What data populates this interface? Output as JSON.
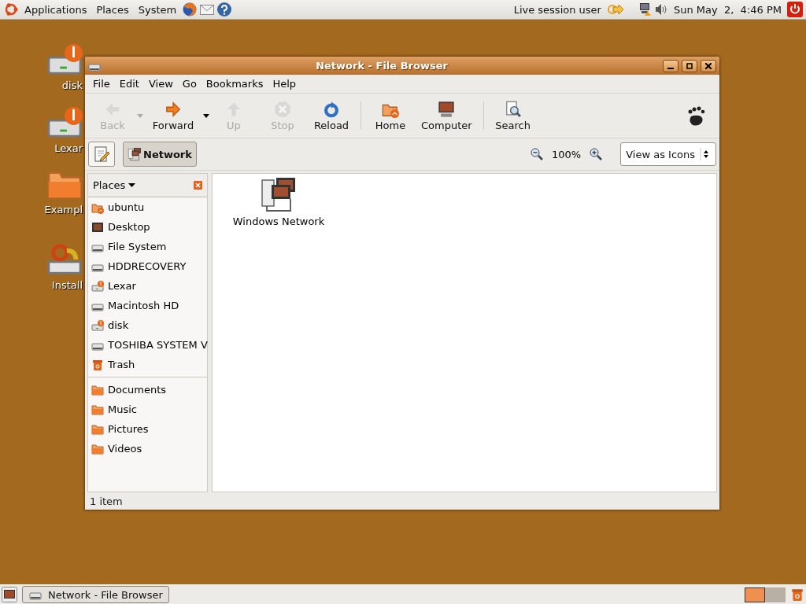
{
  "top_panel": {
    "menus": [
      "Applications",
      "Places",
      "System"
    ],
    "user": "Live session user",
    "clock": "Sun May  2,  4:46 PM"
  },
  "desktop_icons": [
    {
      "label": "disk",
      "kind": "usb"
    },
    {
      "label": "Lexar",
      "kind": "usb"
    },
    {
      "label": "Exampl",
      "kind": "folder"
    },
    {
      "label": "Install",
      "kind": "installer"
    }
  ],
  "window": {
    "title": "Network - File Browser",
    "menus": [
      "File",
      "Edit",
      "View",
      "Go",
      "Bookmarks",
      "Help"
    ],
    "toolbar": [
      {
        "label": "Back",
        "kind": "back",
        "disabled": true,
        "dropdown": true
      },
      {
        "label": "Forward",
        "kind": "forward",
        "disabled": false,
        "dropdown": true
      },
      {
        "label": "Up",
        "kind": "up",
        "disabled": true,
        "dropdown": false
      },
      {
        "label": "Stop",
        "kind": "stop",
        "disabled": true,
        "dropdown": false
      },
      {
        "label": "Reload",
        "kind": "reload",
        "disabled": false,
        "dropdown": false
      },
      {
        "label": "Home",
        "kind": "home",
        "disabled": false,
        "dropdown": false
      },
      {
        "label": "Computer",
        "kind": "computer",
        "disabled": false,
        "dropdown": false
      },
      {
        "label": "Search",
        "kind": "search",
        "disabled": false,
        "dropdown": false
      }
    ],
    "location": {
      "path": "Network",
      "selected": true
    },
    "zoom": "100%",
    "view_mode": "View as Icons",
    "sidebar": {
      "title": "Places",
      "groups": [
        [
          {
            "label": "ubuntu",
            "kind": "home"
          },
          {
            "label": "Desktop",
            "kind": "desktop"
          },
          {
            "label": "File System",
            "kind": "drive"
          },
          {
            "label": "HDDRECOVERY",
            "kind": "drive"
          },
          {
            "label": "Lexar",
            "kind": "usb"
          },
          {
            "label": "Macintosh HD",
            "kind": "drive"
          },
          {
            "label": "disk",
            "kind": "usb"
          },
          {
            "label": "TOSHIBA SYSTEM V",
            "kind": "drive"
          },
          {
            "label": "Trash",
            "kind": "trash"
          }
        ],
        [
          {
            "label": "Documents",
            "kind": "folder"
          },
          {
            "label": "Music",
            "kind": "folder"
          },
          {
            "label": "Pictures",
            "kind": "folder"
          },
          {
            "label": "Videos",
            "kind": "folder"
          }
        ]
      ]
    },
    "items": [
      {
        "label": "Windows Network",
        "kind": "network"
      }
    ],
    "status": "1 item"
  },
  "taskbar": {
    "tasks": [
      {
        "label": "Network - File Browser",
        "selected": false
      }
    ],
    "workspaces": [
      {
        "selected": true
      },
      {
        "selected": false
      }
    ]
  }
}
